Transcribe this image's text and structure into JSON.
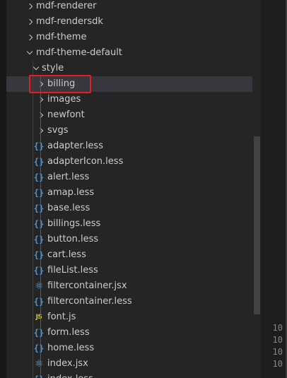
{
  "explorer": {
    "items": [
      {
        "label": "mdf-renderer",
        "kind": "folder",
        "open": false,
        "depth": 0
      },
      {
        "label": "mdf-rendersdk",
        "kind": "folder",
        "open": false,
        "depth": 0
      },
      {
        "label": "mdf-theme",
        "kind": "folder",
        "open": false,
        "depth": 0
      },
      {
        "label": "mdf-theme-default",
        "kind": "folder",
        "open": true,
        "depth": 0
      },
      {
        "label": "style",
        "kind": "folder",
        "open": true,
        "depth": 1
      },
      {
        "label": "billing",
        "kind": "folder",
        "open": false,
        "depth": 2,
        "selected": true
      },
      {
        "label": "images",
        "kind": "folder",
        "open": false,
        "depth": 2
      },
      {
        "label": "newfont",
        "kind": "folder",
        "open": false,
        "depth": 2
      },
      {
        "label": "svgs",
        "kind": "folder",
        "open": false,
        "depth": 2
      },
      {
        "label": "adapter.less",
        "kind": "less",
        "depth": 2
      },
      {
        "label": "adapterIcon.less",
        "kind": "less",
        "depth": 2
      },
      {
        "label": "alert.less",
        "kind": "less",
        "depth": 2
      },
      {
        "label": "amap.less",
        "kind": "less",
        "depth": 2
      },
      {
        "label": "base.less",
        "kind": "less",
        "depth": 2
      },
      {
        "label": "billings.less",
        "kind": "less",
        "depth": 2
      },
      {
        "label": "button.less",
        "kind": "less",
        "depth": 2
      },
      {
        "label": "cart.less",
        "kind": "less",
        "depth": 2
      },
      {
        "label": "fileList.less",
        "kind": "less",
        "depth": 2
      },
      {
        "label": "filtercontainer.jsx",
        "kind": "jsx",
        "depth": 2
      },
      {
        "label": "filtercontainer.less",
        "kind": "less",
        "depth": 2
      },
      {
        "label": "font.js",
        "kind": "js",
        "depth": 2
      },
      {
        "label": "form.less",
        "kind": "less",
        "depth": 2
      },
      {
        "label": "home.less",
        "kind": "less",
        "depth": 2
      },
      {
        "label": "index.jsx",
        "kind": "jsx",
        "depth": 2
      },
      {
        "label": "index.less",
        "kind": "less",
        "depth": 2
      }
    ]
  },
  "icons": {
    "less": "{}",
    "js": "JS",
    "jsx": "⚛"
  },
  "editor": {
    "line_numbers": [
      "10",
      "10",
      "10",
      "10"
    ]
  },
  "colors": {
    "sidebar_bg": "#252526",
    "selected_row": "#37373d",
    "highlight_box": "#e61e24",
    "less_icon": "#4e94ce",
    "js_icon": "#cbcb41",
    "jsx_icon": "#5fb6d9"
  }
}
